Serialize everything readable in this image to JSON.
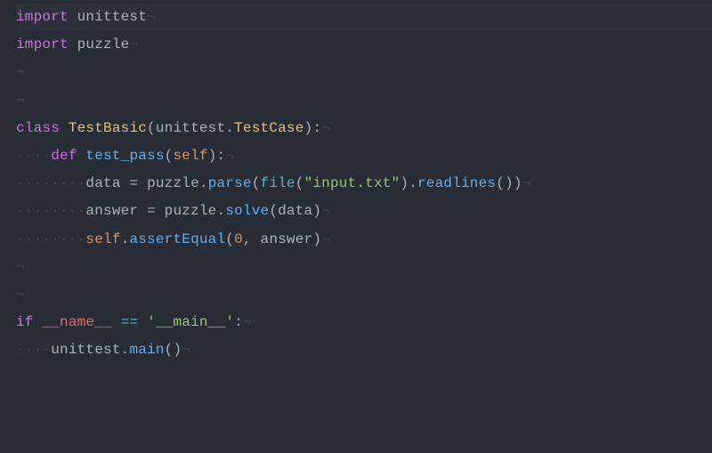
{
  "language": "python",
  "theme": "one-dark",
  "colors": {
    "background": "#282c34",
    "foreground": "#abb2bf",
    "keyword": "#c678dd",
    "class": "#e5c07b",
    "function": "#61afef",
    "string": "#98c379",
    "number": "#d19a66",
    "cyan": "#56b6c2",
    "red": "#e06c75",
    "whitespace": "#3e4451"
  },
  "whitespace_marker": "·",
  "eol_marker": "¬",
  "lines": [
    {
      "highlighted": true,
      "tokens": [
        {
          "t": "import",
          "c": "kw"
        },
        {
          "t": " ",
          "c": "op"
        },
        {
          "t": "unittest",
          "c": "ident"
        },
        {
          "t": "¬",
          "c": "eol"
        }
      ]
    },
    {
      "tokens": [
        {
          "t": "import",
          "c": "kw"
        },
        {
          "t": " ",
          "c": "op"
        },
        {
          "t": "puzzle",
          "c": "ident"
        },
        {
          "t": "¬",
          "c": "eol"
        }
      ]
    },
    {
      "tokens": [
        {
          "t": "¬",
          "c": "eol"
        }
      ]
    },
    {
      "tokens": [
        {
          "t": "¬",
          "c": "eol"
        }
      ]
    },
    {
      "tokens": [
        {
          "t": "class",
          "c": "kw"
        },
        {
          "t": " ",
          "c": "op"
        },
        {
          "t": "TestBasic",
          "c": "cls"
        },
        {
          "t": "(",
          "c": "op"
        },
        {
          "t": "unittest",
          "c": "ident"
        },
        {
          "t": ".",
          "c": "op"
        },
        {
          "t": "TestCase",
          "c": "cls"
        },
        {
          "t": "):",
          "c": "op"
        },
        {
          "t": "¬",
          "c": "eol"
        }
      ]
    },
    {
      "tokens": [
        {
          "t": "····",
          "c": "ws"
        },
        {
          "t": "def",
          "c": "kw"
        },
        {
          "t": " ",
          "c": "op"
        },
        {
          "t": "test_pass",
          "c": "fn"
        },
        {
          "t": "(",
          "c": "op"
        },
        {
          "t": "self",
          "c": "param"
        },
        {
          "t": "):",
          "c": "op"
        },
        {
          "t": "¬",
          "c": "eol"
        }
      ]
    },
    {
      "tokens": [
        {
          "t": "········",
          "c": "ws"
        },
        {
          "t": "data",
          "c": "ident"
        },
        {
          "t": " ",
          "c": "op"
        },
        {
          "t": "=",
          "c": "op"
        },
        {
          "t": " ",
          "c": "op"
        },
        {
          "t": "puzzle",
          "c": "ident"
        },
        {
          "t": ".",
          "c": "op"
        },
        {
          "t": "parse",
          "c": "fn"
        },
        {
          "t": "(",
          "c": "op"
        },
        {
          "t": "file",
          "c": "builtin"
        },
        {
          "t": "(",
          "c": "op"
        },
        {
          "t": "\"input.txt\"",
          "c": "str"
        },
        {
          "t": ").",
          "c": "op"
        },
        {
          "t": "readlines",
          "c": "fn"
        },
        {
          "t": "())",
          "c": "op"
        },
        {
          "t": "¬",
          "c": "eol"
        }
      ]
    },
    {
      "tokens": [
        {
          "t": "········",
          "c": "ws"
        },
        {
          "t": "answer",
          "c": "ident"
        },
        {
          "t": " ",
          "c": "op"
        },
        {
          "t": "=",
          "c": "op"
        },
        {
          "t": " ",
          "c": "op"
        },
        {
          "t": "puzzle",
          "c": "ident"
        },
        {
          "t": ".",
          "c": "op"
        },
        {
          "t": "solve",
          "c": "fn"
        },
        {
          "t": "(",
          "c": "op"
        },
        {
          "t": "data",
          "c": "ident"
        },
        {
          "t": ")",
          "c": "op"
        },
        {
          "t": "¬",
          "c": "eol"
        }
      ]
    },
    {
      "tokens": [
        {
          "t": "········",
          "c": "ws"
        },
        {
          "t": "self",
          "c": "param"
        },
        {
          "t": ".",
          "c": "op"
        },
        {
          "t": "assertEqual",
          "c": "fn"
        },
        {
          "t": "(",
          "c": "op"
        },
        {
          "t": "0",
          "c": "num"
        },
        {
          "t": ", ",
          "c": "op"
        },
        {
          "t": "answer",
          "c": "ident"
        },
        {
          "t": ")",
          "c": "op"
        },
        {
          "t": "¬",
          "c": "eol"
        }
      ]
    },
    {
      "tokens": [
        {
          "t": "¬",
          "c": "eol"
        }
      ]
    },
    {
      "tokens": [
        {
          "t": "¬",
          "c": "eol"
        }
      ]
    },
    {
      "tokens": [
        {
          "t": "if",
          "c": "kw"
        },
        {
          "t": " ",
          "c": "op"
        },
        {
          "t": "__name__",
          "c": "red"
        },
        {
          "t": " ",
          "c": "op"
        },
        {
          "t": "==",
          "c": "op-cyan"
        },
        {
          "t": " ",
          "c": "op"
        },
        {
          "t": "'__main__'",
          "c": "str"
        },
        {
          "t": ":",
          "c": "op"
        },
        {
          "t": "¬",
          "c": "eol"
        }
      ]
    },
    {
      "tokens": [
        {
          "t": "····",
          "c": "ws"
        },
        {
          "t": "unittest",
          "c": "ident"
        },
        {
          "t": ".",
          "c": "op"
        },
        {
          "t": "main",
          "c": "fn"
        },
        {
          "t": "()",
          "c": "op"
        },
        {
          "t": "¬",
          "c": "eol"
        }
      ]
    }
  ]
}
